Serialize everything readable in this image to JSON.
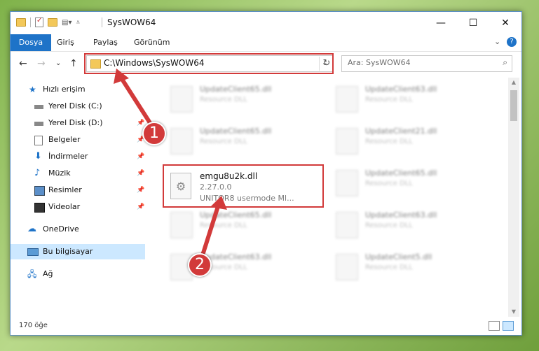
{
  "window": {
    "title": "SysWOW64",
    "controls": {
      "minimize": "—",
      "maximize": "☐",
      "close": "✕"
    }
  },
  "ribbon": {
    "tabs": [
      "Dosya",
      "Giriş",
      "Paylaş",
      "Görünüm"
    ],
    "expand": "⌄",
    "help": "?"
  },
  "nav": {
    "back": "←",
    "forward": "→",
    "recent": "⌄",
    "up": "↑",
    "address": "C:\\Windows\\SysWOW64",
    "refresh": "↻",
    "search_placeholder": "Ara: SysWOW64"
  },
  "sidebar": {
    "items": [
      {
        "label": "Hızlı erişim",
        "icon": "star-icon",
        "pinned": false
      },
      {
        "label": "Yerel Disk (C:)",
        "icon": "drive-icon",
        "pinned": false
      },
      {
        "label": "Yerel Disk (D:)",
        "icon": "drive-icon",
        "pinned": true
      },
      {
        "label": "Belgeler",
        "icon": "documents-icon",
        "pinned": true
      },
      {
        "label": "İndirmeler",
        "icon": "download-icon",
        "pinned": true
      },
      {
        "label": "Müzik",
        "icon": "music-icon",
        "pinned": true
      },
      {
        "label": "Resimler",
        "icon": "pictures-icon",
        "pinned": true
      },
      {
        "label": "Videolar",
        "icon": "video-icon",
        "pinned": true
      },
      {
        "label": "OneDrive",
        "icon": "cloud-icon",
        "pinned": false
      },
      {
        "label": "Bu bilgisayar",
        "icon": "computer-icon",
        "pinned": false
      },
      {
        "label": "Ağ",
        "icon": "network-icon",
        "pinned": false
      }
    ]
  },
  "files": {
    "highlighted": {
      "name": "emgu8u2k.dll",
      "version": "2.27.0.0",
      "description": "UNITOR8 usermode Ml..."
    },
    "blurred_left": [
      {
        "name": "UpdateClient65.dll",
        "type": "Resource DLL"
      },
      {
        "name": "UpdateClient65.dll",
        "type": "Resource DLL"
      },
      {
        "name": "UpdateClient65.dll",
        "type": "Resource DLL"
      },
      {
        "name": "UpdateClient63.dll",
        "type": "Resource DLL"
      }
    ],
    "blurred_right": [
      {
        "name": "UpdateClient63.dll",
        "type": "Resource DLL"
      },
      {
        "name": "UpdateClient21.dll",
        "type": "Resource DLL"
      },
      {
        "name": "UpdateClient65.dll",
        "type": "Resource DLL"
      },
      {
        "name": "UpdateClient63.dll",
        "type": "Resource DLL"
      },
      {
        "name": "UpdateClient5.dll",
        "type": "Resource DLL"
      }
    ]
  },
  "status": {
    "count": "170 öğe"
  },
  "annotations": {
    "step1": "1",
    "step2": "2"
  },
  "colors": {
    "accent": "#1e73c8",
    "highlight": "#d23a3a"
  }
}
